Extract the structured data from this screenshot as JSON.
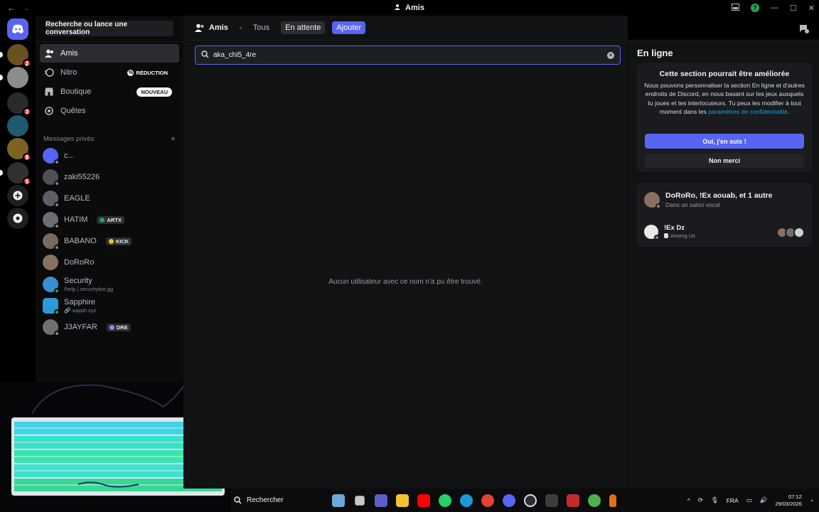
{
  "window": {
    "title": "Amis",
    "nav_back": "←",
    "nav_forward": "→",
    "help": "?"
  },
  "sidebar": {
    "search_button": "Recherche ou lance une conversation",
    "nav": [
      {
        "label": "Amis",
        "icon": "friends-icon",
        "active": true
      },
      {
        "label": "Nitro",
        "icon": "nitro-icon",
        "badge": "RÉDUCTION"
      },
      {
        "label": "Boutique",
        "icon": "shop-icon",
        "badge": "NOUVEAU"
      },
      {
        "label": "Quêtes",
        "icon": "quests-icon"
      }
    ],
    "dm_header": "Messages privés",
    "dm_add": "+",
    "dms": [
      {
        "name": "c...",
        "sub": "",
        "tag": "",
        "avatar_color": "#5865f2"
      },
      {
        "name": "zaki55226",
        "sub": "",
        "tag": "",
        "avatar_color": "#4e5058"
      },
      {
        "name": "EAGLE",
        "sub": "",
        "tag": "",
        "avatar_color": "#5c5f66"
      },
      {
        "name": "HATIM",
        "sub": "",
        "tag": "ARTX",
        "avatar_color": "#6b6e73"
      },
      {
        "name": "BABANO",
        "sub": "",
        "tag": "KICK",
        "avatar_color": "#7a6a5c"
      },
      {
        "name": "DoRoRo",
        "sub": "",
        "tag": "",
        "avatar_color": "#8a7060"
      },
      {
        "name": "Security",
        "sub": "/help | securitybot.gg",
        "tag": "",
        "avatar_color": "#3a8fd0"
      },
      {
        "name": "Sapphire",
        "sub": "sapph.xyz",
        "tag": "",
        "avatar_color": "#2a9bd8"
      },
      {
        "name": "J3AYFAR",
        "sub": "",
        "tag": "DRE",
        "avatar_color": "#707070"
      }
    ]
  },
  "rail": {
    "badges": [
      "2",
      "3",
      "8",
      "5"
    ]
  },
  "topbar": {
    "friends_label": "Amis",
    "tab_all": "Tous",
    "tab_pending": "En attente",
    "tab_add": "Ajouter"
  },
  "search": {
    "value": "aka_chi5_4re",
    "empty_message": "Aucun utilisateur avec ce nom n'a pu être trouvé."
  },
  "right_panel": {
    "title": "En ligne",
    "promo": {
      "heading": "Cette section pourrait être améliorée",
      "body": "Nous pouvons personnaliser la section En ligne et d'autres endroits de Discord, en nous basant sur les jeux auxquels tu joues et tes interlocuteurs. Tu peux les modifier à tout moment dans les ",
      "link": "paramètres de confidentialité",
      "body_end": ".",
      "yes": "Oui, j'en suis !",
      "no": "Non merci"
    },
    "activity": {
      "title": "DoRoRo, !Ex aouab, et 1 autre",
      "subtitle": "Dans un salon vocal",
      "member": "!Ex Dz",
      "game": "Among Us"
    }
  },
  "taskbar": {
    "search": "Rechercher",
    "lang": "FRA",
    "time": "07:12",
    "date": "29/03/2026"
  }
}
